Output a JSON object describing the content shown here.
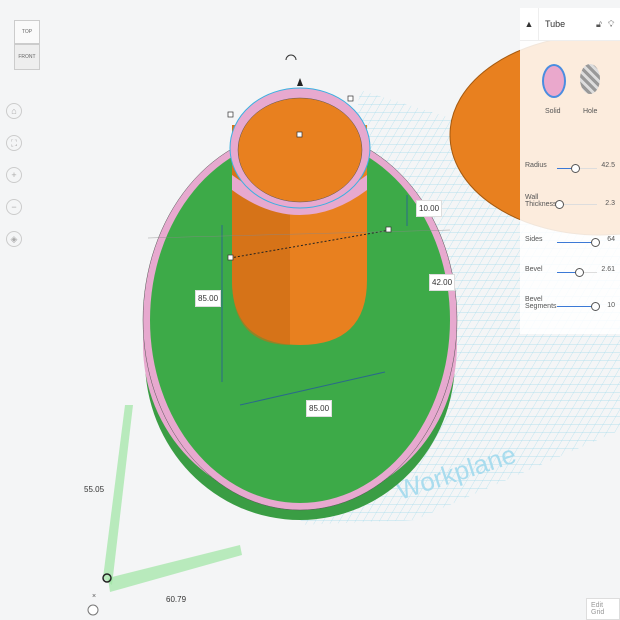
{
  "viewcube": {
    "top": "TOP",
    "front": "FRONT"
  },
  "nav": {
    "home_icon": "home-icon",
    "fit_icon": "fit-icon",
    "zoom_in": "+",
    "zoom_out": "−",
    "perspective_icon": "perspective-icon"
  },
  "dimensions": {
    "height_top": "10.00",
    "height_right": "42.00",
    "left_height": "85.00",
    "width": "85.00",
    "workplane_y": "55.05",
    "workplane_x": "60.79"
  },
  "workplane_label": "Workplane",
  "panel": {
    "title": "Tube",
    "solid": "Solid",
    "hole": "Hole",
    "params": [
      {
        "label": "Radius",
        "value": "42.5",
        "fraction": 0.45
      },
      {
        "label": "Wall Thickness",
        "value": "2.3",
        "fraction": 0.0
      },
      {
        "label": "Sides",
        "value": "64",
        "fraction": 1.0
      },
      {
        "label": "Bevel",
        "value": "2.61",
        "fraction": 0.55
      },
      {
        "label": "Bevel Segments",
        "value": "10",
        "fraction": 1.0
      }
    ]
  },
  "colors": {
    "orange": "#e8801f",
    "green": "#3daa48",
    "pink": "#e7a9cf",
    "grid": "#7fd0e8",
    "selection": "#3b79d6"
  },
  "edit_grid": "Edit Grid"
}
